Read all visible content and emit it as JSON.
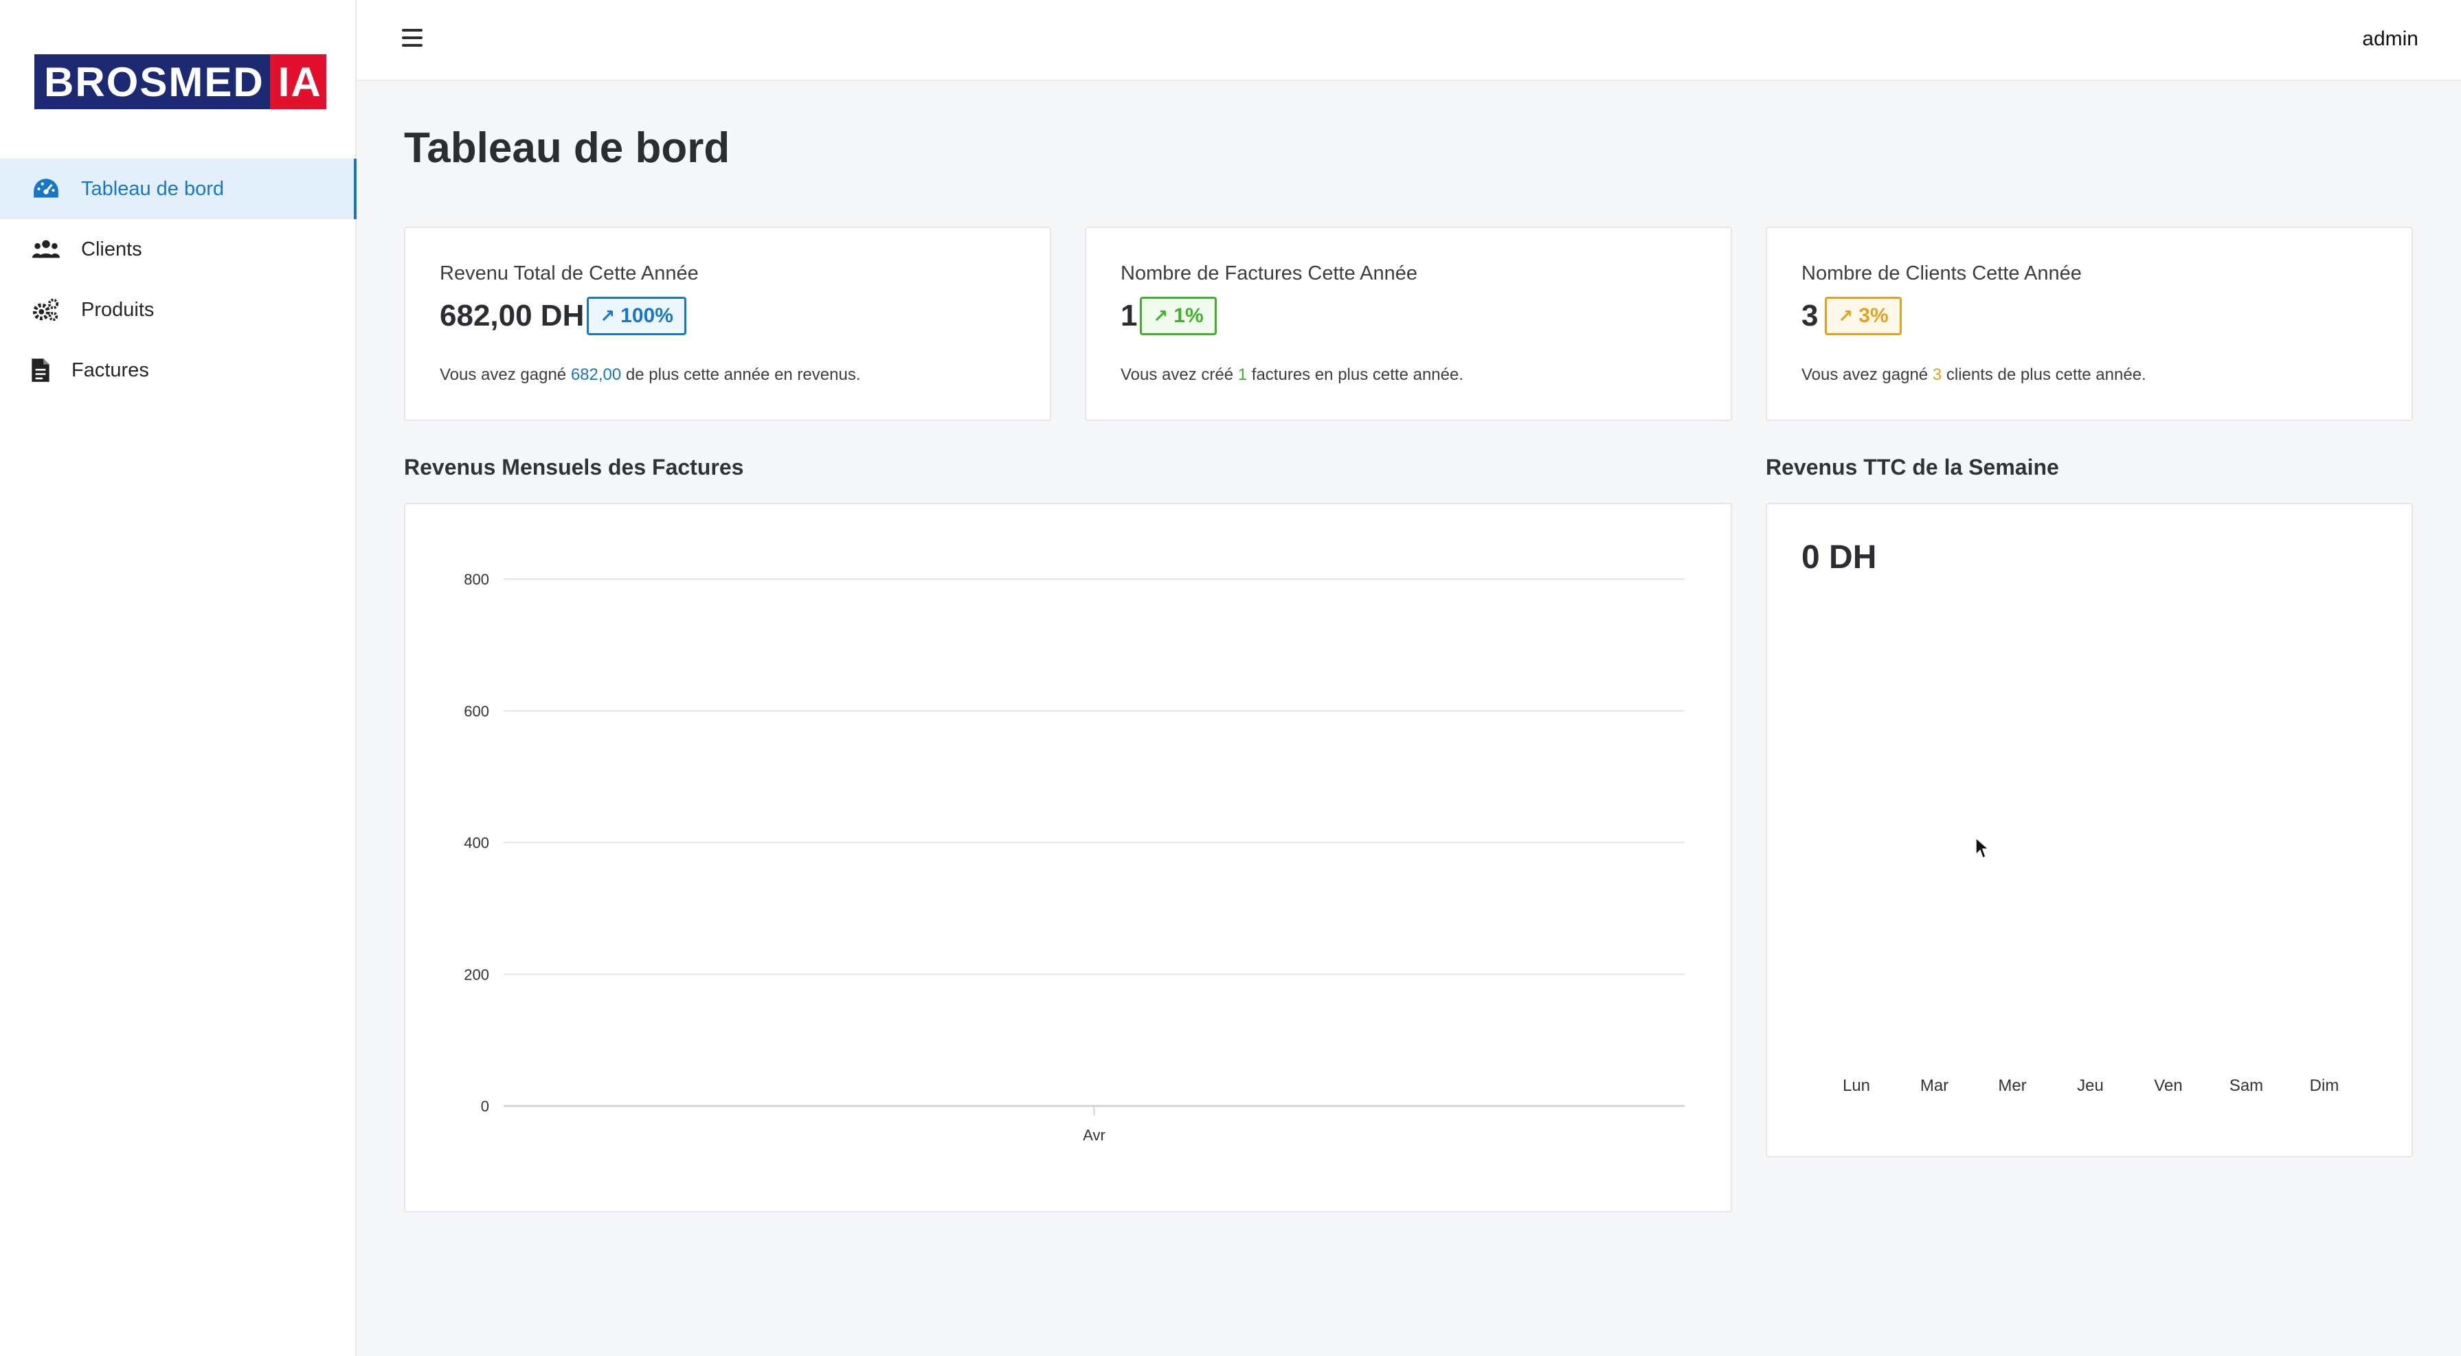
{
  "sidebar": {
    "logo": {
      "main": "BROSMED",
      "accent": "IA"
    },
    "items": [
      {
        "label": "Tableau de bord",
        "icon": "dashboard-gauge-icon",
        "active": true
      },
      {
        "label": "Clients",
        "icon": "users-icon",
        "active": false
      },
      {
        "label": "Produits",
        "icon": "gears-icon",
        "active": false
      },
      {
        "label": "Factures",
        "icon": "document-icon",
        "active": false
      }
    ]
  },
  "topbar": {
    "menu_icon": "hamburger-menu-icon",
    "user": "admin"
  },
  "page": {
    "title": "Tableau de bord"
  },
  "stats": [
    {
      "title": "Revenu Total de Cette Année",
      "value": "682,00 DH",
      "badge": "100%",
      "badge_icon": "trend-up-icon",
      "desc_before": "Vous avez gagné ",
      "desc_highlight": "682,00",
      "desc_after": " de plus cette année en revenus.",
      "color": "#1677c7"
    },
    {
      "title": "Nombre de Factures Cette Année",
      "value": "1",
      "badge": "1%",
      "badge_icon": "trend-up-icon",
      "desc_before": "Vous avez créé ",
      "desc_highlight": "1",
      "desc_after": " factures en plus cette année.",
      "color": "#3fb12a"
    },
    {
      "title": "Nombre de Clients Cette Année",
      "value": "3",
      "badge": "3%",
      "badge_icon": "trend-up-icon",
      "desc_before": "Vous avez gagné ",
      "desc_highlight": "3",
      "desc_after": " clients de plus cette année.",
      "color": "#e2a21b"
    }
  ],
  "monthly": {
    "title": "Revenus Mensuels des Factures",
    "chart_data": {
      "type": "bar",
      "title": "",
      "xlabel": "",
      "ylabel": "",
      "categories": [
        "Avr"
      ],
      "values": [
        0
      ],
      "yticks": [
        0,
        200,
        400,
        600,
        800
      ],
      "ylim": [
        0,
        800
      ],
      "grid": true
    }
  },
  "weekly": {
    "title": "Revenus TTC de la Semaine",
    "amount": "0 DH",
    "chart_data": {
      "type": "bar",
      "title": "",
      "categories": [
        "Lun",
        "Mar",
        "Mer",
        "Jeu",
        "Ven",
        "Sam",
        "Dim"
      ],
      "values": [
        0,
        0,
        0,
        0,
        0,
        0,
        0
      ],
      "grid": false
    }
  }
}
